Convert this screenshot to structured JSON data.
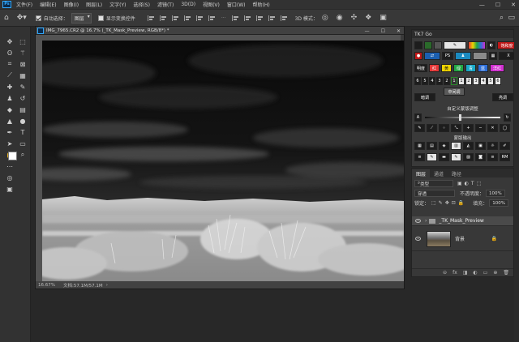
{
  "menubar": {
    "logo": "Ps",
    "items": [
      "文件(F)",
      "编辑(E)",
      "图像(I)",
      "图层(L)",
      "文字(Y)",
      "选择(S)",
      "滤镜(T)",
      "3D(D)",
      "视图(V)",
      "窗口(W)",
      "帮助(H)"
    ],
    "window_controls": [
      "—",
      "☐",
      "✕"
    ]
  },
  "optionsbar": {
    "auto_select_label": "自动选择：",
    "auto_select_target": "图层",
    "show_transform_label": "显示变换控件",
    "mode_3d": "3D 模式：",
    "more": "···"
  },
  "document": {
    "tab_title": "IMG_7965.CR2 @ 16.7% (_TK_Mask_Preview, RGB/8*) *",
    "zoom": "16.67%",
    "doc_size": "文档:57.1M/57.1M"
  },
  "tk_panel": {
    "title": "TK7 Go",
    "row2": [
      "PS",
      "X"
    ],
    "row2_label": "饱和度",
    "row3_labels": [
      "明度",
      "红",
      "黄",
      "绿",
      "青",
      "蓝",
      "洋红"
    ],
    "numbers": [
      "6",
      "5",
      "4",
      "3",
      "2",
      "1",
      "1",
      "2",
      "3",
      "4",
      "5",
      "6"
    ],
    "midtones": "中间调",
    "shadows": "暗调",
    "highlights": "亮调",
    "custom_label": "自定义蒙版调整",
    "slider_a": "A",
    "output_label": "蒙版输出",
    "rm": "RM"
  },
  "layers": {
    "tabs": [
      "图层",
      "通道",
      "路径"
    ],
    "kind_label": "类型",
    "blend_mode": "穿透",
    "opacity_label": "不透明度：",
    "opacity_value": "100%",
    "lock_label": "锁定：",
    "fill_label": "填充：",
    "fill_value": "100%",
    "items": [
      {
        "name": "_TK_Mask_Preview",
        "type": "group"
      },
      {
        "name": "背景",
        "type": "image"
      }
    ],
    "footer_icons": [
      "link-icon",
      "fx-icon",
      "mask-icon",
      "adjustment-icon",
      "folder-icon",
      "new-layer-icon",
      "trash-icon"
    ],
    "footer_glyphs": [
      "⊝",
      "fx",
      "◨",
      "◐",
      "▭",
      "⊕",
      "🗑"
    ]
  },
  "colors": {
    "ps_blue": "#31a8ff",
    "panel": "#383838",
    "red": "#e63838",
    "green": "#22a644",
    "yellow": "#f0d400",
    "blue": "#2f70d8",
    "magenta": "#d030d0"
  }
}
